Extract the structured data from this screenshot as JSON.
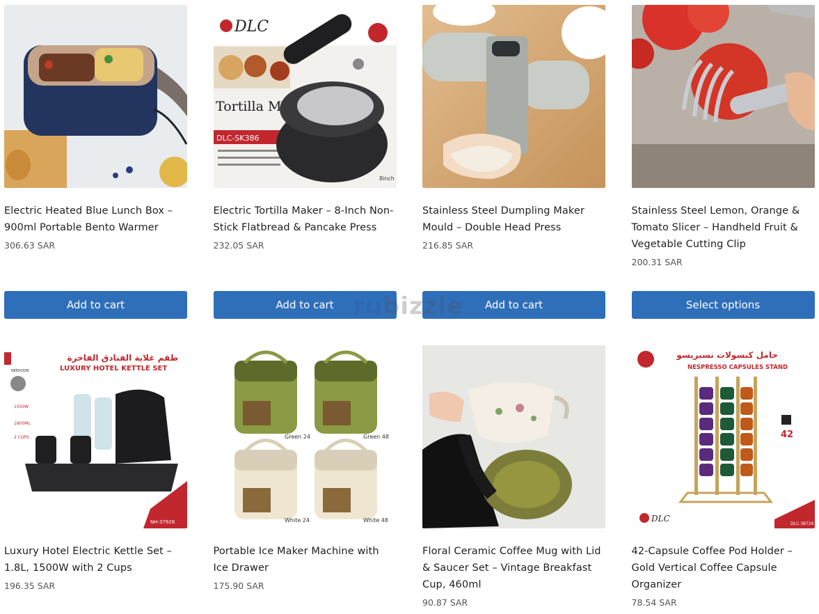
{
  "watermark": {
    "part1": "ru",
    "part2": "bizzle"
  },
  "products": [
    {
      "title": "Electric Heated Blue Lunch Box – 900ml Portable Bento Warmer",
      "price": "306.63 SAR",
      "button": "Add to cart",
      "image_icon": "lunch-box-image"
    },
    {
      "title": "Electric Tortilla Maker – 8-Inch Non-Stick Flatbread & Pancake Press",
      "price": "232.05 SAR",
      "button": "Add to cart",
      "image_icon": "tortilla-maker-image",
      "image_text": {
        "brand": "DLC",
        "name": "Tortilla Maker",
        "model": "DLC-SK386",
        "size": "8inch"
      }
    },
    {
      "title": "Stainless Steel Dumpling Maker Mould – Double Head Press",
      "price": "216.85 SAR",
      "button": "Add to cart",
      "image_icon": "dumpling-maker-image"
    },
    {
      "title": "Stainless Steel Lemon, Orange & Tomato Slicer – Handheld Fruit & Vegetable Cutting Clip",
      "price": "200.31 SAR",
      "button": "Select options",
      "image_icon": "tomato-slicer-image"
    },
    {
      "title": "Luxury Hotel Electric Kettle Set – 1.8L, 1500W with 2 Cups",
      "price": "196.35 SAR",
      "image_icon": "kettle-set-image",
      "image_text": {
        "arabic": "طقم غلاية الفنادق الفاخرة",
        "heading": "LUXURY HOTEL KETTLE SET",
        "brand": "NEEHOON",
        "power": "1500W",
        "capacity": "1800ML",
        "cups": "2 CUPS",
        "model": "NH-37926"
      }
    },
    {
      "title": "Portable Ice Maker Machine with Ice Drawer",
      "price": "175.90 SAR",
      "image_icon": "ice-maker-image",
      "image_text": {
        "l1": "Green 24",
        "l2": "Green 48",
        "l3": "White 24",
        "l4": "White 48"
      }
    },
    {
      "title": "Floral Ceramic Coffee Mug with Lid & Saucer Set – Vintage Breakfast Cup, 460ml",
      "price": "90.87 SAR",
      "image_icon": "coffee-mug-image"
    },
    {
      "title": "42-Capsule Coffee Pod Holder – Gold Vertical Coffee Capsule Organizer",
      "price": "78.54 SAR",
      "image_icon": "capsule-holder-image",
      "image_text": {
        "arabic": "حامل كبسولات نسبريسو",
        "heading": "NESPRESSO CAPSULES STAND",
        "count": "42",
        "brand": "DLC",
        "model": "DLC-38726"
      }
    }
  ]
}
